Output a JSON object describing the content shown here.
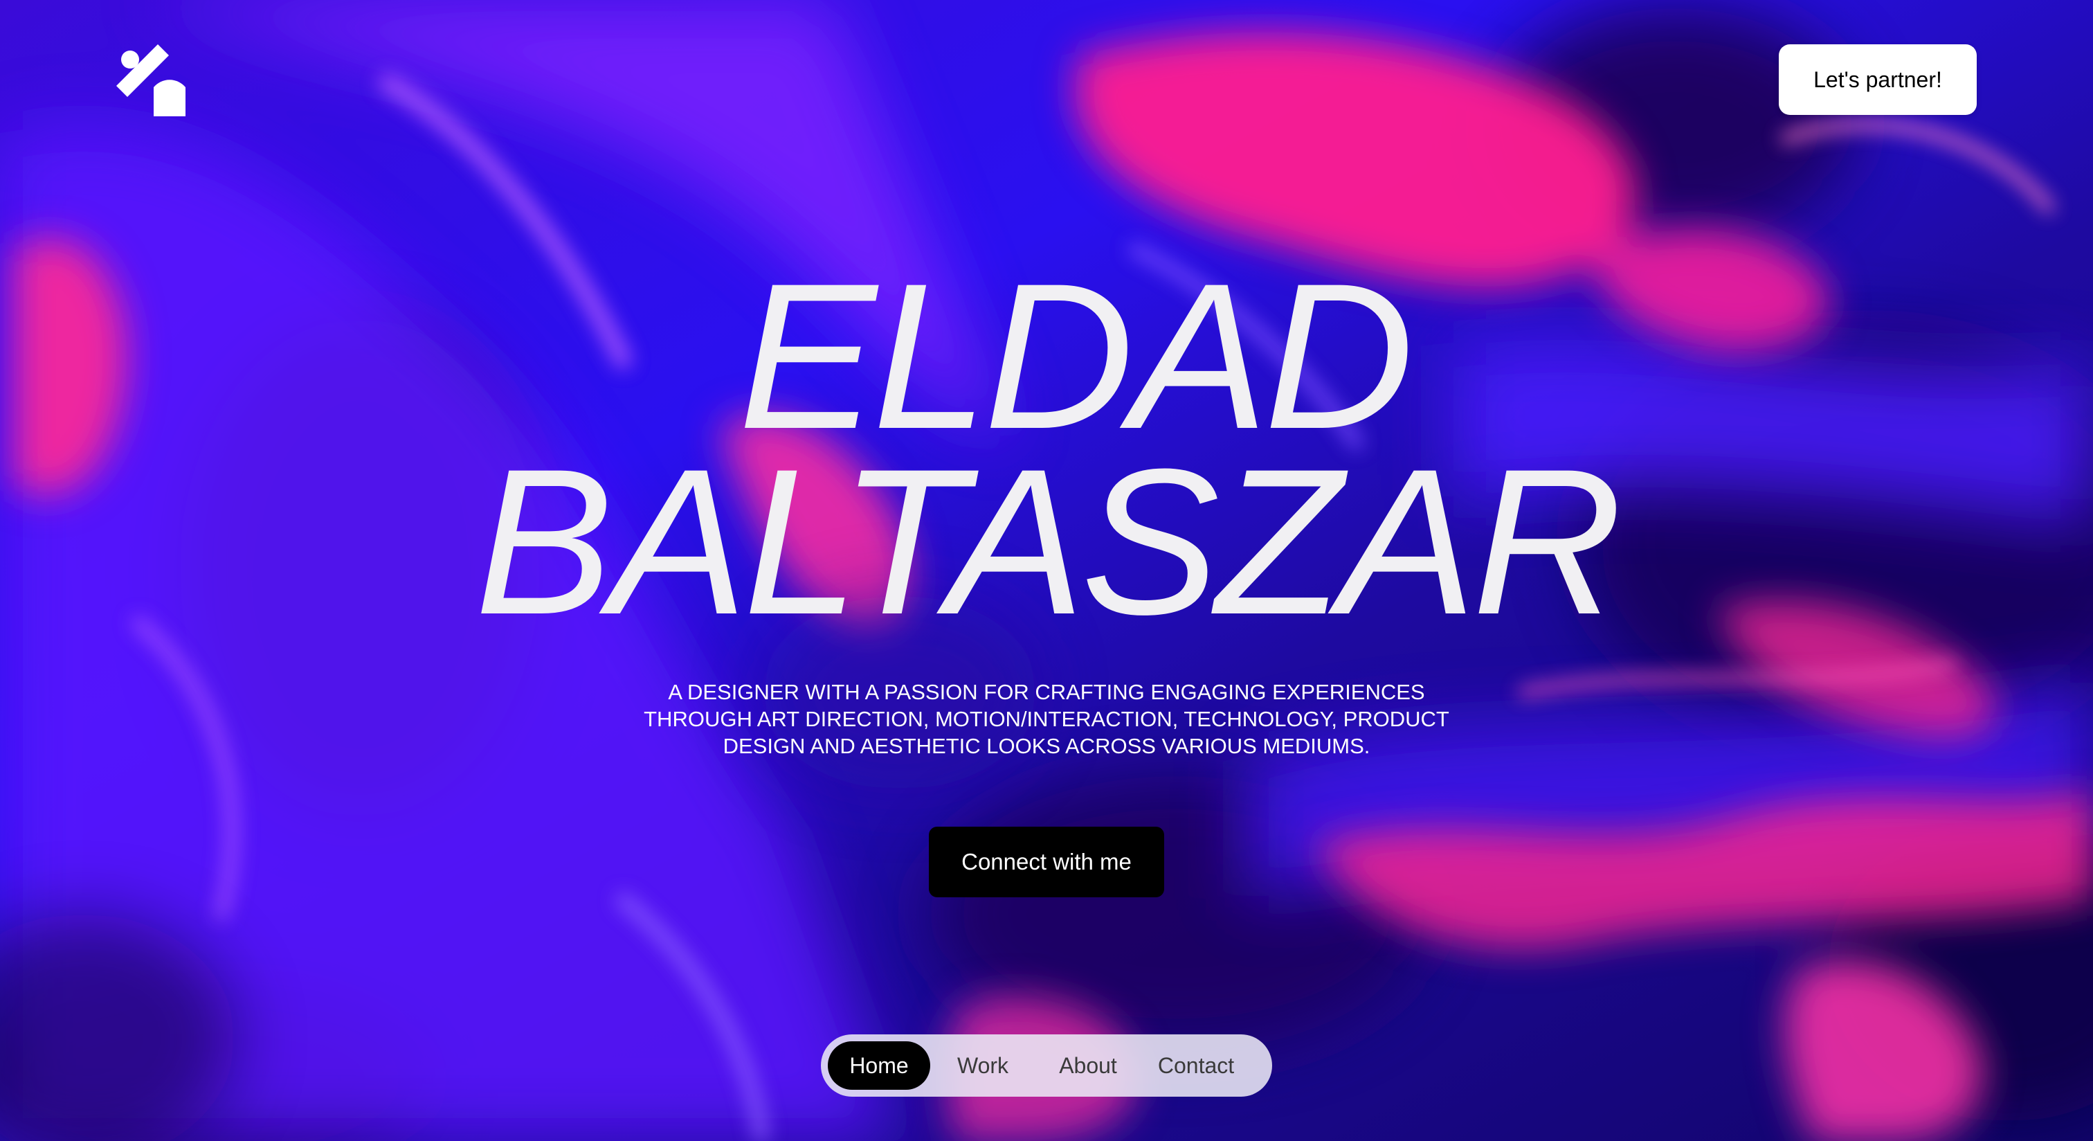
{
  "header": {
    "logo_icon": "brand-mark-icon",
    "partner_button_label": "Let's partner!"
  },
  "hero": {
    "name_line1": "ELDAD",
    "name_line2": "BALTASZAR",
    "tagline_line1": "A designer with a passion for crafting engaging experiences",
    "tagline_line2": "through art direction, motion/interaction, technology, product",
    "tagline_line3": "design and aesthetic looks across various mediums.",
    "cta_label": "Connect with me"
  },
  "nav": {
    "items": [
      {
        "label": "Home",
        "active": true
      },
      {
        "label": "Work",
        "active": false
      },
      {
        "label": "About",
        "active": false
      },
      {
        "label": "Contact",
        "active": false
      }
    ]
  },
  "colors": {
    "background_base": "#2a0cff",
    "accent_magenta": "#ff1f8f",
    "accent_violet": "#8a1dff",
    "deep_indigo": "#14036b",
    "text_light": "#f1f0f3",
    "button_dark": "#000000",
    "button_light": "#ffffff"
  }
}
